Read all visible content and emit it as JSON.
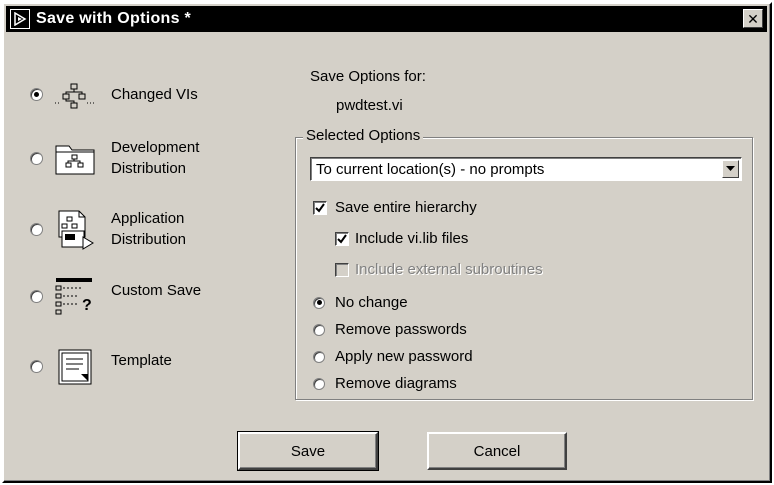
{
  "window": {
    "title": "Save with Options *",
    "icons": {
      "app": "labview-run-arrow-icon",
      "close": "close-icon"
    }
  },
  "options": [
    {
      "label": "Changed VIs",
      "icon": "changed-vis-hierarchy-icon",
      "selected": true
    },
    {
      "label": "Development\nDistribution",
      "icon": "development-distribution-folder-icon",
      "selected": false
    },
    {
      "label": "Application\nDistribution",
      "icon": "application-distribution-icon",
      "selected": false
    },
    {
      "label": "Custom Save",
      "icon": "custom-save-icon",
      "selected": false
    },
    {
      "label": "Template",
      "icon": "template-icon",
      "selected": false
    }
  ],
  "save_options": {
    "heading": "Save Options for:",
    "vi_name": "pwdtest.vi"
  },
  "selected_options": {
    "group_title": "Selected Options",
    "location_select": {
      "value": "To current location(s) - no prompts"
    },
    "checkboxes": [
      {
        "label": "Save entire hierarchy",
        "checked": true,
        "enabled": true
      },
      {
        "label": "Include vi.lib files",
        "checked": true,
        "enabled": true
      },
      {
        "label": "Include external subroutines",
        "checked": false,
        "enabled": false
      }
    ],
    "password_radios": [
      {
        "label": "No change",
        "selected": true
      },
      {
        "label": "Remove passwords",
        "selected": false
      },
      {
        "label": "Apply new password",
        "selected": false
      },
      {
        "label": "Remove diagrams",
        "selected": false
      }
    ]
  },
  "buttons": {
    "save": "Save",
    "cancel": "Cancel"
  },
  "colors": {
    "dialog_bg": "#d4d0c8",
    "titlebar_bg": "#000000",
    "disabled_text": "#808080"
  }
}
